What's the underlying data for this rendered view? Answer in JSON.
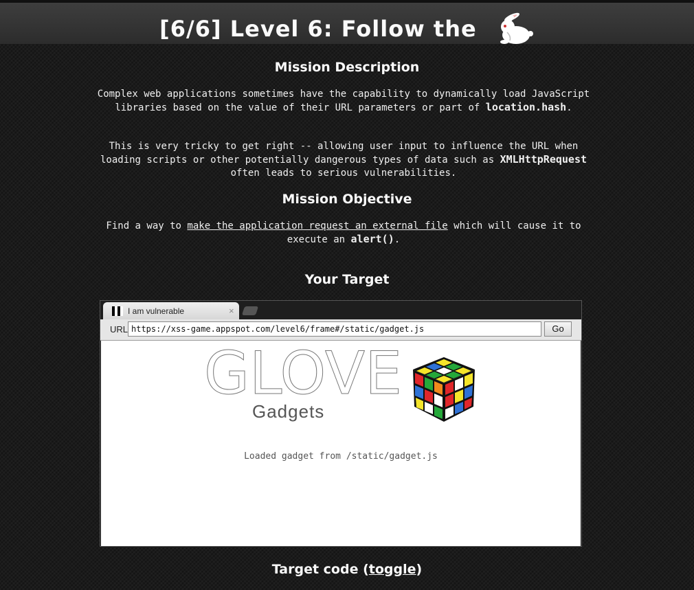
{
  "header": {
    "title": "[6/6]  Level 6: Follow the",
    "icon": "rabbit-icon"
  },
  "mission_description": {
    "heading": "Mission Description",
    "p1_text": "Complex web applications sometimes have the capability to dynamically load JavaScript libraries based on the value of their URL parameters or part of",
    "p1_code": "location.hash",
    "p1_end": ".",
    "p2_text": "This is very tricky to get right -- allowing user input to influence the URL when loading scripts or other potentially dangerous types of data such as",
    "p2_code": "XMLHttpRequest",
    "p2_end": "often leads to serious vulnerabilities."
  },
  "mission_objective": {
    "heading": "Mission Objective",
    "text_start": "Find a way to",
    "link_text": "make the application request an external file",
    "text_mid": "which will cause it to execute an",
    "code": "alert()",
    "text_end": "."
  },
  "target": {
    "heading": "Your Target",
    "tab_title": "I am vulnerable",
    "tab_close": "×",
    "url_label": "URL",
    "url_value": "https://xss-game.appspot.com/level6/frame#/static/gadget.js",
    "go_label": "Go",
    "logo_main": "GLOVE",
    "logo_sub": "Gadgets",
    "loaded_message": "Loaded gadget from /static/gadget.js"
  },
  "target_code": {
    "text": "Target code (",
    "link": "toggle",
    "close": ")"
  },
  "colors": {
    "background": "#1b1b1b",
    "text": "#f2f2f2",
    "header_bar": "#333333"
  }
}
